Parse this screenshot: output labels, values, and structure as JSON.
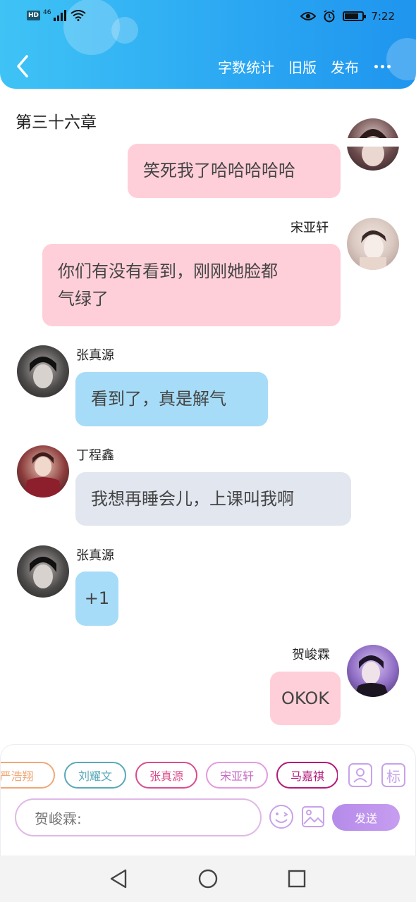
{
  "status_bar": {
    "network_badge": "HD",
    "signal_label": "46",
    "time": "7:22"
  },
  "header": {
    "back_icon": "chevron-left-icon",
    "actions": {
      "word_count": "字数统计",
      "old_version": "旧版",
      "publish": "发布"
    },
    "more_icon": "more-dots-icon"
  },
  "chapter": {
    "title": "第三十六章"
  },
  "messages": [
    {
      "side": "right",
      "speaker": "",
      "text": "笑死我了哈哈哈哈哈",
      "bubble_color": "#ffcfd9"
    },
    {
      "side": "right",
      "speaker": "宋亚轩",
      "text_line1": "你们有没有看到，刚刚她脸都",
      "text_line2": "气绿了",
      "bubble_color": "#ffcfd9"
    },
    {
      "side": "left",
      "speaker": "张真源",
      "text": "看到了，真是解气",
      "bubble_color": "#a6dcf7"
    },
    {
      "side": "left",
      "speaker": "丁程鑫",
      "text": "我想再睡会儿，上课叫我啊",
      "bubble_color": "#e1e6ef"
    },
    {
      "side": "left",
      "speaker": "张真源",
      "text": "+1",
      "bubble_color": "#a6dcf7"
    },
    {
      "side": "right",
      "speaker": "贺峻霖",
      "text": "OKOK",
      "bubble_color": "#ffcfd9"
    }
  ],
  "composer": {
    "character_chips": [
      {
        "label": "严浩翔",
        "color": "#f0a877"
      },
      {
        "label": "刘耀文",
        "color": "#5aa9b8"
      },
      {
        "label": "张真源",
        "color": "#d84d8c"
      },
      {
        "label": "宋亚轩",
        "color": "#e39adf"
      },
      {
        "label": "马嘉祺",
        "color": "#b2187a"
      }
    ],
    "contacts_icon": "person-icon",
    "tag_label": "标",
    "input_prefix": "贺峻霖:",
    "emoji_icon": "emoji-icon",
    "image_icon": "image-icon",
    "send_label": "发送"
  },
  "system_nav": {
    "back": "back-triangle-icon",
    "home": "home-circle-icon",
    "recents": "recents-square-icon"
  }
}
